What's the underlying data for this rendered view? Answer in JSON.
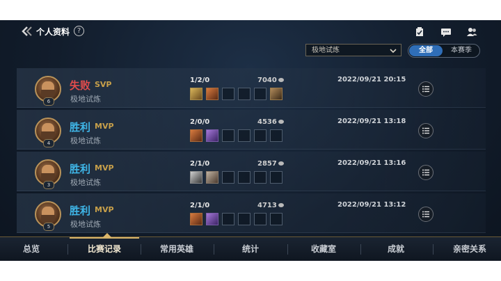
{
  "header": {
    "back_icon": "chevron-left-icon",
    "title": "个人资料",
    "help_label": "?",
    "icons": [
      "clipboard-check-icon",
      "chat-bubble-icon",
      "friends-icon"
    ]
  },
  "filters": {
    "mode_select_value": "极地试炼",
    "toggle_all": "全部",
    "toggle_season": "本赛季"
  },
  "matches": [
    {
      "result": "失败",
      "result_type": "loss",
      "rank": "SVP",
      "mode": "极地试炼",
      "level": "6",
      "kda": "1/2/0",
      "gold": "7040",
      "time": "2022/09/21 20:15",
      "items": [
        "f1",
        "f2",
        "",
        "",
        "",
        "f6"
      ]
    },
    {
      "result": "胜利",
      "result_type": "win",
      "rank": "MVP",
      "mode": "极地试炼",
      "level": "4",
      "kda": "2/0/0",
      "gold": "4536",
      "time": "2022/09/21 13:18",
      "items": [
        "f2",
        "f3",
        "",
        "",
        "",
        ""
      ]
    },
    {
      "result": "胜利",
      "result_type": "win",
      "rank": "MVP",
      "mode": "极地试炼",
      "level": "3",
      "kda": "2/1/0",
      "gold": "2857",
      "time": "2022/09/21 13:16",
      "items": [
        "f4",
        "f5",
        "",
        "",
        "",
        ""
      ]
    },
    {
      "result": "胜利",
      "result_type": "win",
      "rank": "MVP",
      "mode": "极地试炼",
      "level": "5",
      "kda": "2/1/0",
      "gold": "4713",
      "time": "2022/09/21 13:12",
      "items": [
        "f2",
        "f3",
        "",
        "",
        "",
        ""
      ]
    }
  ],
  "nav": {
    "items": [
      "总览",
      "比赛记录",
      "常用英雄",
      "统计",
      "收藏室",
      "成就",
      "亲密关系"
    ],
    "active": "比赛记录"
  },
  "colors": {
    "loss": "#e14c4c",
    "win": "#3fb6e8",
    "rank": "#c8a04a",
    "accent": "#2f6eb8"
  }
}
